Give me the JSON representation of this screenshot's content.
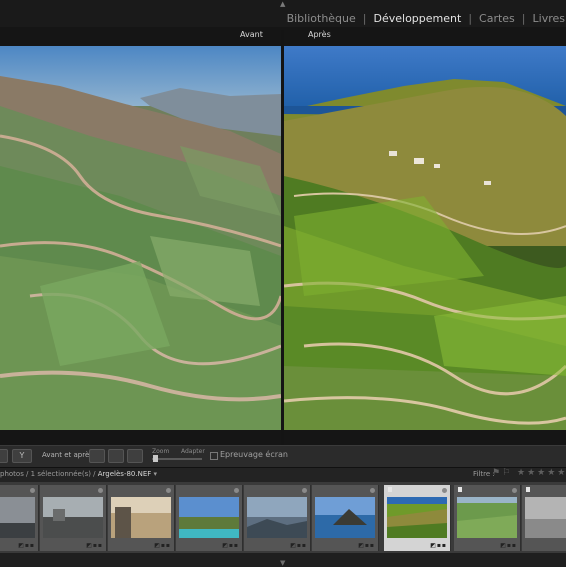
{
  "nav": {
    "modules": [
      "Bibliothèque",
      "Développement",
      "Cartes",
      "Livres"
    ],
    "active": "Développement"
  },
  "compare": {
    "before_label": "Avant",
    "after_label": "Après"
  },
  "toolbar": {
    "compare_label": "Avant et après :",
    "zoom_label": "Zoom",
    "fit_label": "Adapter",
    "softproof_label": "Epreuvage écran",
    "view_icon": "Y"
  },
  "filmstrip": {
    "source_prefix": "photos / 1 sélectionnée(s) /",
    "filename": "Argelès-80.NEF",
    "filter_label": "Filtre :",
    "thumbs": [
      "coast-gray",
      "coast-rocks",
      "sunset-ruins",
      "bay-harbor",
      "bay-mountains",
      "sea-cape",
      "vineyard-selected",
      "vineyard-green",
      "bw-landscape"
    ]
  },
  "icons": {
    "top_arrow": "▲",
    "bottom_arrow": "▼"
  }
}
